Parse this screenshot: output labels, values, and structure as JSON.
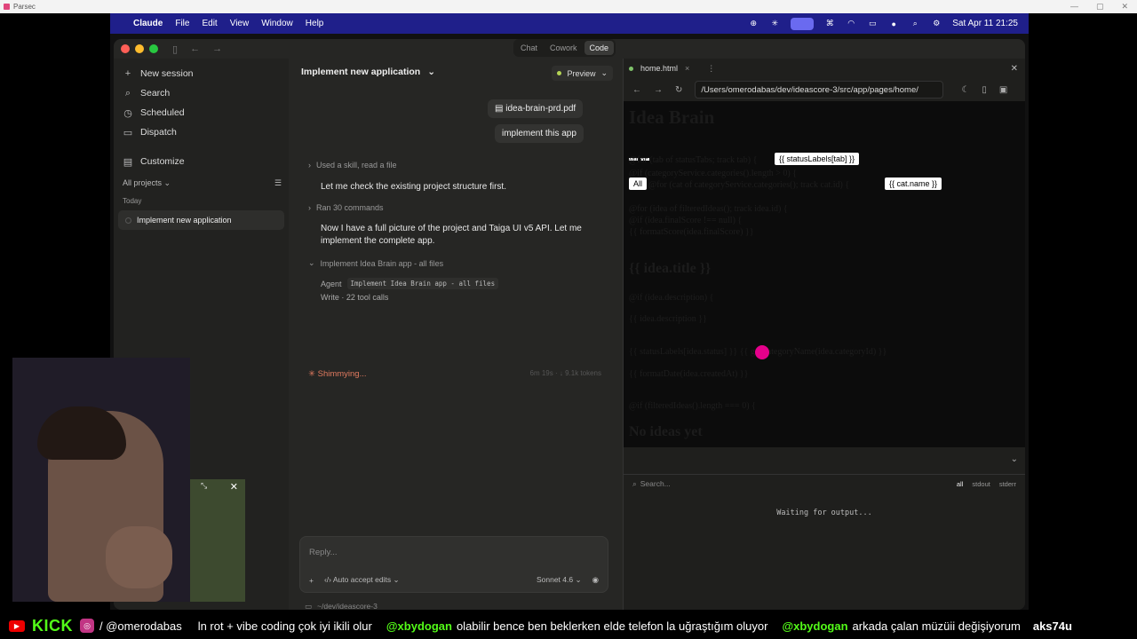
{
  "parsec": {
    "title": "Parsec",
    "controls": [
      "—",
      "▢",
      "✕"
    ]
  },
  "menubar": {
    "app": "Claude",
    "items": [
      "File",
      "Edit",
      "View",
      "Window",
      "Help"
    ],
    "datetime": "Sat Apr 11  21:25"
  },
  "window": {
    "modes": [
      "Chat",
      "Cowork",
      "Code"
    ],
    "active_mode": "Code"
  },
  "sidebar": {
    "items": [
      {
        "label": "New session",
        "icon": "+"
      },
      {
        "label": "Search",
        "icon": "⌕"
      },
      {
        "label": "Scheduled",
        "icon": "◷"
      },
      {
        "label": "Dispatch",
        "icon": "▭"
      },
      {
        "label": "Customize",
        "icon": "▤"
      }
    ],
    "projects_label": "All projects",
    "section": "Today",
    "session": "Implement new application"
  },
  "chat": {
    "title": "Implement new application",
    "preview": "Preview",
    "attachment": "idea-brain-prd.pdf",
    "user_msg": "implement this app",
    "step1": "Used a skill, read a file",
    "para1": "Let me check the existing project structure first.",
    "step2": "Ran 30 commands",
    "para2": "Now I have a full picture of the project and Taiga UI v5 API. Let me implement the complete app.",
    "step3": "Implement Idea Brain app - all files",
    "agent_label": "Agent",
    "agent_task": "Implement Idea Brain app - all files",
    "write_line": "Write · 22 tool calls",
    "status": "Shimmying...",
    "status_time": "6m 19s · ↓ 9.1k tokens",
    "reply_placeholder": "Reply...",
    "auto_accept": "Auto accept edits",
    "model": "Sonnet 4.6",
    "cwd": "~/dev/ideascore-3"
  },
  "preview_panel": {
    "tab": "home.html",
    "url": "/Users/omerodabas/dev/ideascore-3/src/app/pages/home/",
    "page_title": "Idea Brain",
    "chip_status": "{{ statusLabels[tab] }}",
    "chip_all": "All",
    "chip_cat": "{{ cat.name }}",
    "idea_title": "{{ idea.title }}",
    "empty": "No ideas yet",
    "line1": "@for (tab of statusTabs; track tab) {",
    "line2": "@if (categoryService.categories().length > 0) {",
    "line3": "@for (cat of categoryService.categories(); track cat.id) {",
    "line4": "@for (idea of filteredIdeas(); track idea.id) {",
    "line5": "@if (idea.finalScore !== null) {",
    "line6": "{{ formatScore(idea.finalScore) }}",
    "line7": "@if (idea.description) {",
    "line8": "{{ idea.description }}",
    "line9": "{{ statusLabels[idea.status] }}  {{ getCategoryName(idea.categoryId) }}",
    "line10": "{{ formatDate(idea.createdAt) }}",
    "line11": "@if (filteredIdeas().length === 0) {",
    "console_search": "Search...",
    "filters": [
      "all",
      "stdout",
      "stderr"
    ],
    "console_msg": "Waiting for output..."
  },
  "ticker": {
    "kick": "KICK",
    "handle": "/ @omerodabas",
    "msg1": "ln rot + vibe coding çok iyi ikili olur",
    "user1": "@xbydogan",
    "msg2": "olabilir bence ben beklerken elde telefon la uğraştığım oluyor",
    "user2": "@xbydogan",
    "msg3": "arkada çalan müzüii değişiyorum",
    "user3": "aks74u"
  }
}
